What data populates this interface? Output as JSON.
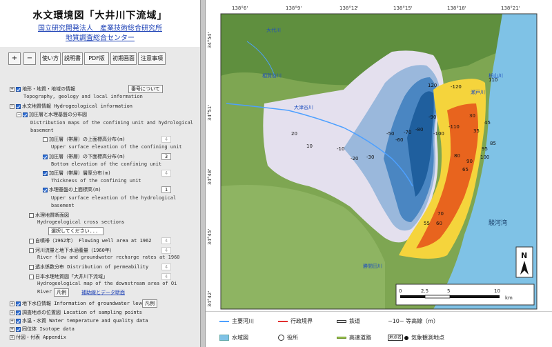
{
  "header": {
    "title": "水文環境図「大井川下流域」",
    "org1": "国立研究開発法人　産業技術総合研究所",
    "org2": "地質調査総合センター"
  },
  "toolbar": {
    "zoom_in": "+",
    "zoom_out": "−",
    "usage": "使い方",
    "manual": "説明書",
    "pdf": "PDF版",
    "home": "初期画面",
    "notice": "注意事項"
  },
  "layers": {
    "topo": {
      "label": "地形・地質・地域の情報",
      "sub": "Topography, geology and local information",
      "btn": "番号について"
    },
    "hydro": {
      "label": "水文地質情報 Hydrogeological information"
    },
    "confining": {
      "label": "加圧層と水理基盤の分布図",
      "sub": "Distribution maps of the confining unit and hydrological basement"
    },
    "upper": {
      "label": "加圧層（帯層）の上面標高分布(m)",
      "sub": "Upper surface elevation of the confining unit",
      "sel": "4"
    },
    "lower": {
      "label": "加圧層（帯層）の下面標高分布(m)",
      "sub": "Bottom elevation of the confining unit",
      "sel": "3"
    },
    "thick": {
      "label": "加圧層（帯層）層厚分布(m)",
      "sub": "Thickness of the confining unit",
      "sel": "4"
    },
    "basement": {
      "label": "水理基盤の上面標高(m)",
      "sub": "Upper surface elevation of the hydrological basement",
      "sel": "1"
    },
    "cross": {
      "label": "水理地質断面図",
      "sub": "Hydrogeological cross sections",
      "select": "選択してください..."
    },
    "flowing": {
      "label": "自噴帯（1962年） Flowing well area at 1962",
      "sel": "4"
    },
    "river": {
      "label": "河川流量と地下水涵養量（1960年）",
      "sub": "River flow and groundwater recharge rates at 1960",
      "sel": "4"
    },
    "perm": {
      "label": "透水係数分布 Distribution of permeability",
      "sel": "4"
    },
    "japan": {
      "label": "日本水理地質図「大井川下流域」",
      "sub": "Hydrogeological map of the downstream area of Oi",
      "sub2": "River",
      "btn": "凡例",
      "link": "補助線とデータ断面",
      "sel": "4"
    },
    "gwlevel": {
      "label": "地下水位情報 Information of groundwater level",
      "btn": "凡例"
    },
    "sampling": {
      "label": "調査地点の位置図 Location of sampling points"
    },
    "quality": {
      "label": "水温・水質 Water temperature and quality data"
    },
    "isotope": {
      "label": "同位体 Isotope data"
    },
    "appendix": {
      "label": "付図・付表 Appendix"
    }
  },
  "map": {
    "lon_ticks": [
      "138°6'",
      "138°9'",
      "138°12'",
      "138°15'",
      "138°18'",
      "138°21'"
    ],
    "lat_ticks": [
      "34°54'",
      "34°51'",
      "34°48'",
      "34°45'",
      "34°42'"
    ],
    "place_labels": [
      "大代川",
      "相賀谷川",
      "大津谷川",
      "瀬戸川",
      "栃山川",
      "勝間田川",
      "駿河湾"
    ],
    "contour_labels": [
      "-120",
      "-110",
      "-100",
      "-90",
      "-80",
      "-70",
      "-60",
      "-50",
      "-30",
      "-20",
      "-10",
      "10",
      "20",
      "30",
      "35",
      "45",
      "55",
      "60",
      "65",
      "70",
      "80",
      "85",
      "90",
      "95",
      "100",
      "110",
      "120"
    ],
    "north": "N",
    "scale_values": [
      "0",
      "2.5",
      "5",
      "10"
    ],
    "scale_unit": "km",
    "colors": {
      "sea": "#7fc2e6",
      "land": "#7ea652",
      "shallow": "#e4e0ee",
      "deep": "#1f5f9e",
      "positive_low": "#f5d43c",
      "positive_high": "#e8641e"
    }
  },
  "legend": {
    "river": "主要河川",
    "pref": "行政境界",
    "rail": "鉄道",
    "contour": "−10− 等高線（m）",
    "water": "水域図",
    "office": "役所",
    "highway": "高速道路",
    "obs": "気象観測地点",
    "obs_tag": "地点名"
  }
}
